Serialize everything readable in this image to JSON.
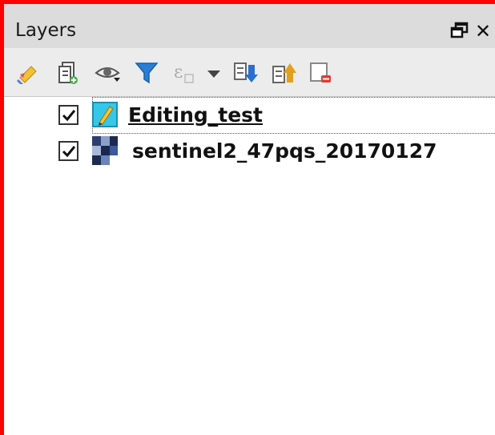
{
  "panel": {
    "title": "Layers",
    "float_icon": "float-window-icon",
    "close_label": "✕"
  },
  "toolbar": {
    "items": [
      {
        "name": "style-panel-icon"
      },
      {
        "name": "add-group-icon"
      },
      {
        "name": "visibility-eye-icon"
      },
      {
        "name": "filter-legend-icon"
      },
      {
        "name": "filter-expression-icon"
      },
      {
        "name": "dropdown-arrow-icon"
      },
      {
        "name": "expand-all-icon"
      },
      {
        "name": "collapse-all-icon"
      },
      {
        "name": "remove-layer-icon"
      }
    ]
  },
  "layers": [
    {
      "name": "Editing_test",
      "checked": true,
      "icon": "vector-edit-icon",
      "active": true
    },
    {
      "name": "sentinel2_47pqs_20170127",
      "checked": true,
      "icon": "raster-layer-icon",
      "active": false
    }
  ],
  "colors": {
    "border": "#ff0000",
    "titlebar": "#dcdcdc",
    "toolbar": "#ececec"
  }
}
